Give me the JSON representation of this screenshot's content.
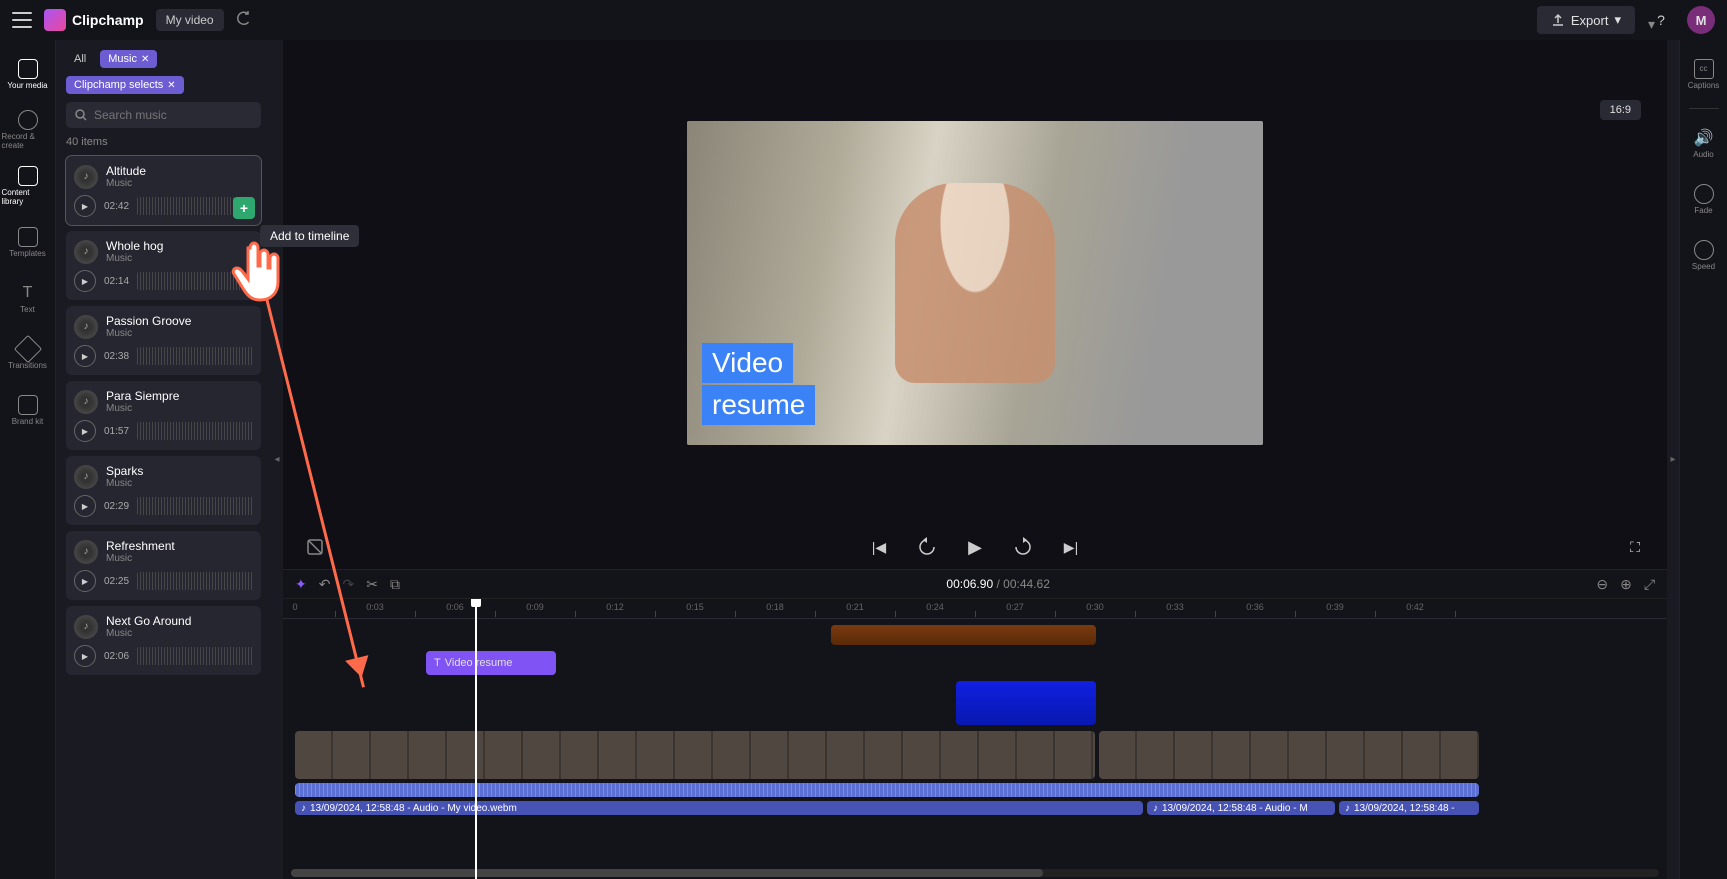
{
  "header": {
    "app_name": "Clipchamp",
    "project_name": "My video",
    "export_label": "Export",
    "help_glyph": "?",
    "avatar_letter": "M"
  },
  "left_rail": [
    {
      "label": "Your media"
    },
    {
      "label": "Record & create"
    },
    {
      "label": "Content library"
    },
    {
      "label": "Templates"
    },
    {
      "label": "Text"
    },
    {
      "label": "Transitions"
    },
    {
      "label": "Brand kit"
    }
  ],
  "side_panel": {
    "chips": {
      "all": "All",
      "music": "Music",
      "selects": "Clipchamp selects"
    },
    "search_placeholder": "Search music",
    "item_count": "40 items",
    "tooltip": "Add to timeline",
    "subtitle": "Music",
    "tracks": [
      {
        "title": "Altitude",
        "duration": "02:42",
        "selected": true,
        "has_add": true
      },
      {
        "title": "Whole hog",
        "duration": "02:14"
      },
      {
        "title": "Passion Groove",
        "duration": "02:38"
      },
      {
        "title": "Para Siempre",
        "duration": "01:57"
      },
      {
        "title": "Sparks",
        "duration": "02:29"
      },
      {
        "title": "Refreshment",
        "duration": "02:25"
      },
      {
        "title": "Next Go Around",
        "duration": "02:06"
      }
    ]
  },
  "preview": {
    "overlay_line1": "Video",
    "overlay_line2": "resume",
    "aspect": "16:9"
  },
  "right_rail": [
    {
      "label": "Captions"
    },
    {
      "label": "Audio"
    },
    {
      "label": "Fade"
    },
    {
      "label": "Speed"
    }
  ],
  "timeline_bar": {
    "current": "00:06.90",
    "sep": "/",
    "total": "00:44.62"
  },
  "ruler": [
    "0",
    "0:03",
    "0:06",
    "0:09",
    "0:12",
    "0:15",
    "0:18",
    "0:21",
    "0:24",
    "0:27",
    "0:30",
    "0:33",
    "0:36",
    "0:39",
    "0:42"
  ],
  "clips": {
    "text_label": "Video resume",
    "audio1": "13/09/2024, 12:58:48 - Audio - My video.webm",
    "audio2": "13/09/2024, 12:58:48 - Audio - M",
    "audio3": "13/09/2024, 12:58:48 -"
  }
}
